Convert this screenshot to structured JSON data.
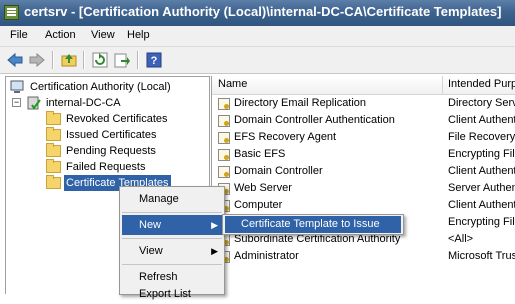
{
  "window": {
    "title": "certsrv - [Certification Authority (Local)\\internal-DC-CA\\Certificate Templates]"
  },
  "menu": [
    "File",
    "Action",
    "View",
    "Help"
  ],
  "toolbar": {
    "icons": [
      "back-icon",
      "forward-icon",
      "up-folder-icon",
      "refresh-icon",
      "export-icon",
      "help-icon"
    ]
  },
  "tree": {
    "root": "Certification Authority (Local)",
    "ca": "internal-DC-CA",
    "folders": [
      "Revoked Certificates",
      "Issued Certificates",
      "Pending Requests",
      "Failed Requests",
      "Certificate Templates"
    ]
  },
  "list": {
    "columns": [
      "Name",
      "Intended Purp"
    ],
    "rows": [
      {
        "name": "Directory Email Replication",
        "purpose": "Directory Serv"
      },
      {
        "name": "Domain Controller Authentication",
        "purpose": "Client Authent"
      },
      {
        "name": "EFS Recovery Agent",
        "purpose": "File Recovery"
      },
      {
        "name": "Basic EFS",
        "purpose": "Encrypting File"
      },
      {
        "name": "Domain Controller",
        "purpose": "Client Authent"
      },
      {
        "name": "Web Server",
        "purpose": "Server Authen"
      },
      {
        "name": "Computer",
        "purpose": "Client Authent"
      },
      {
        "name": "",
        "purpose": "Encrypting File"
      },
      {
        "name": "Subordinate Certification Authority",
        "purpose": "<All>"
      },
      {
        "name": "Administrator",
        "purpose": "Microsoft Trus"
      }
    ]
  },
  "context_menu": {
    "items": [
      "Manage",
      "New",
      "View",
      "Refresh",
      "Export List"
    ]
  },
  "submenu": {
    "item": "Certificate Template to Issue"
  },
  "colors": {
    "title_bar": "#3f6390",
    "selection": "#2f62a6",
    "menu_bg": "#f0f0f0"
  }
}
